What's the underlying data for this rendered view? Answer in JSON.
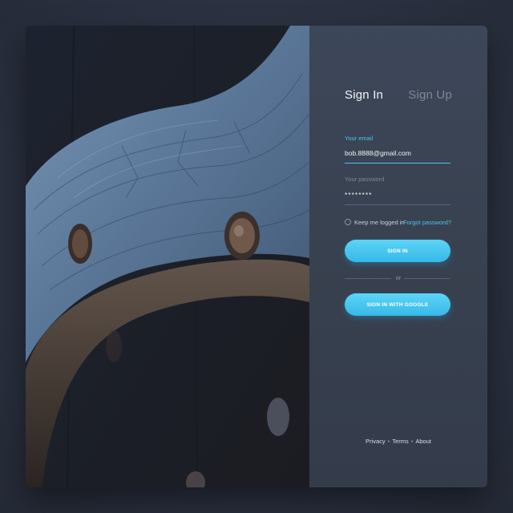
{
  "tabs": {
    "sign_in": "Sign In",
    "sign_up": "Sign Up"
  },
  "form": {
    "email_label": "Your email",
    "email_value": "bob.8888@gmail.com",
    "password_label": "Your password",
    "password_value": "********",
    "remember_label": "Keep me logged in",
    "forgot_link": "Forgot password?",
    "sign_in_button": "SIGN IN",
    "or_text": "or",
    "google_button": "SIGN IN WITH GOOGLE"
  },
  "footer": {
    "privacy": "Privacy",
    "terms": "Terms",
    "about": "About",
    "separator": "•"
  },
  "colors": {
    "accent": "#4fc3ec",
    "panel": "#3a4356",
    "background": "#2c3242"
  }
}
